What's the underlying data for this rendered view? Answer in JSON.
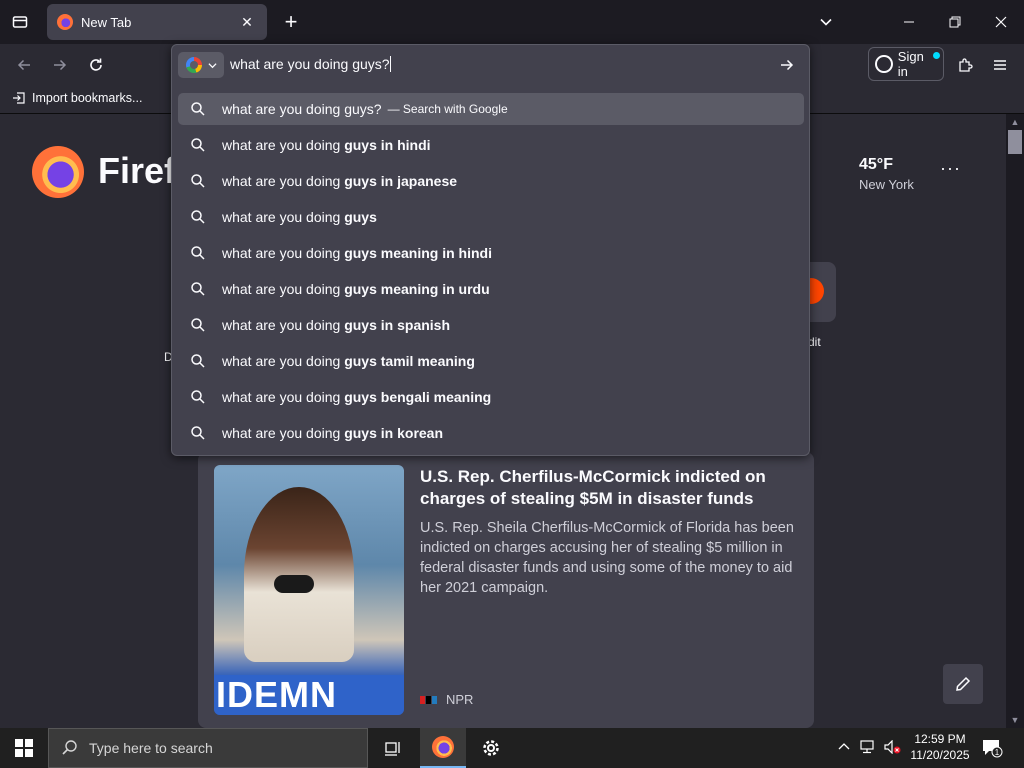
{
  "browser": {
    "tab_title": "New Tab",
    "bookmark_import": "Import bookmarks...",
    "sign_in": "Sign in"
  },
  "urlbar": {
    "query": "what are you doing guys?",
    "engine_icon": "google-icon",
    "first": {
      "text": "what are you doing guys?",
      "action": "— Search with Google"
    },
    "suggestions": [
      {
        "prefix": "what are you doing ",
        "bold": "guys in hindi"
      },
      {
        "prefix": "what are you doing ",
        "bold": "guys in japanese"
      },
      {
        "prefix": "what are you doing ",
        "bold": "guys"
      },
      {
        "prefix": "what are you doing ",
        "bold": "guys meaning in hindi"
      },
      {
        "prefix": "what are you doing ",
        "bold": "guys meaning in urdu"
      },
      {
        "prefix": "what are you doing ",
        "bold": "guys in spanish"
      },
      {
        "prefix": "what are you doing ",
        "bold": "guys tamil meaning"
      },
      {
        "prefix": "what are you doing ",
        "bold": "guys bengali meaning"
      },
      {
        "prefix": "what are you doing ",
        "bold": "guys in korean"
      }
    ]
  },
  "newtab": {
    "brand": "Firef",
    "weather_temp": "45°F",
    "weather_location": "New York",
    "shortcut_label": "dit",
    "left_fragment": "D",
    "news": {
      "title": "U.S. Rep. Cherfilus-McCormick indicted on charges of stealing $5M in disaster funds",
      "excerpt": "U.S. Rep. Sheila Cherfilus-McCormick of Florida has been indicted on charges accusing her of stealing $5 million in federal disaster funds and using some of the money to aid her 2021 campaign.",
      "source": "NPR",
      "image_banner": "IDEMN"
    }
  },
  "taskbar": {
    "search_placeholder": "Type here to search",
    "time": "12:59 PM",
    "date": "11/20/2025",
    "notification_count": "1"
  },
  "colors": {
    "accent": "#00ddff",
    "npr_red": "#d62021",
    "npr_black": "#000000",
    "npr_blue": "#237bbd"
  }
}
